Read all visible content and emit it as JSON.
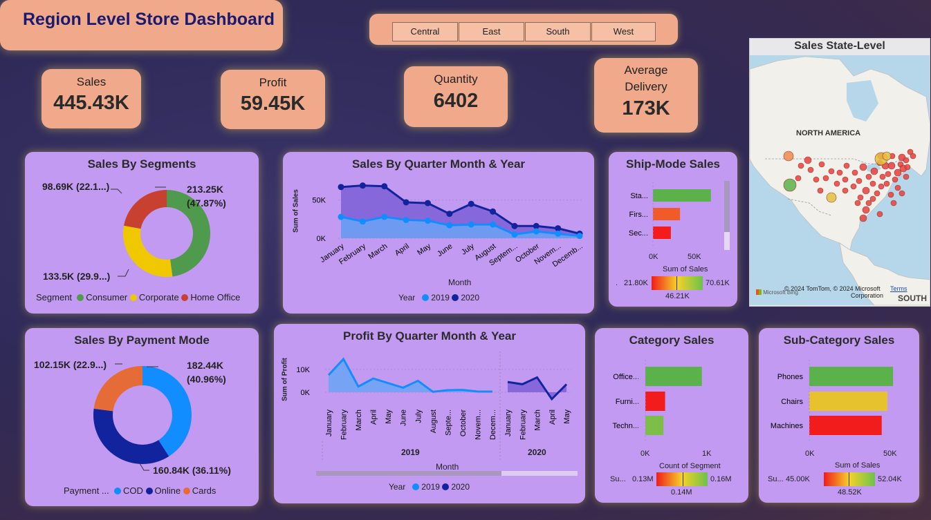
{
  "title": "Region Level Store Dashboard",
  "regions": [
    "Central",
    "East",
    "South",
    "West"
  ],
  "kpis": {
    "sales": {
      "label": "Sales",
      "value": "445.43K"
    },
    "profit": {
      "label": "Profit",
      "value": "59.45K"
    },
    "quantity": {
      "label": "Quantity",
      "value": "6402"
    },
    "delivery": {
      "label1": "Average",
      "label2": "Delivery",
      "value": "173K"
    }
  },
  "segments": {
    "title": "Sales By Segments",
    "legend_title": "Segment",
    "labels": {
      "consumer_1": "213.25K",
      "consumer_2": "(47.87%)",
      "corporate": "133.5K (29.9...)",
      "home": "98.69K (22.1...)"
    },
    "colors": {
      "Consumer": "#4f9a4d",
      "Corporate": "#f0c800",
      "Home Office": "#c84030"
    }
  },
  "payment": {
    "title": "Sales By Payment Mode",
    "legend_title": "Payment ...",
    "labels": {
      "cod_1": "182.44K",
      "cod_2": "(40.96%)",
      "online": "160.84K (36.11%)",
      "cards": "102.15K (22.9...)"
    },
    "colors": {
      "COD": "#118dff",
      "Online": "#12239e",
      "Cards": "#e66c37"
    }
  },
  "sales_qm": {
    "title": "Sales By Quarter Month & Year",
    "ylabel": "Sum of Sales",
    "xlabel": "Month",
    "legend_title": "Year",
    "month_labels": [
      "January",
      "February",
      "March",
      "April",
      "May",
      "June",
      "July",
      "August",
      "Septem...",
      "October",
      "Novem...",
      "Decemb..."
    ],
    "ytick_labels": [
      "50K",
      "0K"
    ]
  },
  "profit_qm": {
    "title": "Profit By Quarter Month & Year",
    "ylabel": "Sum of Profit",
    "xlabel": "Month",
    "legend_title": "Year",
    "month_labels_2019": [
      "January",
      "February",
      "March",
      "April",
      "May",
      "June",
      "July",
      "August",
      "Septe...",
      "October",
      "Novem...",
      "Decem..."
    ],
    "month_labels_2020": [
      "January",
      "February",
      "March",
      "April",
      "May"
    ],
    "year_labels": [
      "2019",
      "2020"
    ],
    "ytick_labels": [
      "10K",
      "0K"
    ]
  },
  "ship": {
    "title": "Ship-Mode Sales",
    "categories": [
      "Sta...",
      "Firs...",
      "Sec..."
    ],
    "ticks": [
      "0K",
      "50K"
    ],
    "axis_title": "Sum of Sales",
    "gradient": {
      "min": "21.80K",
      "mid": "46.21K",
      "max": "70.61K",
      "prefix": "."
    }
  },
  "category": {
    "title": "Category Sales",
    "categories": [
      "Office...",
      "Furni...",
      "Techn..."
    ],
    "ticks": [
      "0K",
      "1K"
    ],
    "axis_title": "Count of Segment",
    "gradient": {
      "min": "0.13M",
      "mid": "0.14M",
      "max": "0.16M",
      "prefix": "Su..."
    }
  },
  "subcategory": {
    "title": "Sub-Category Sales",
    "categories": [
      "Phones",
      "Chairs",
      "Machines"
    ],
    "ticks": [
      "0K",
      "50K"
    ],
    "axis_title": "Sum of Sales",
    "gradient": {
      "min": "45.00K",
      "mid": "48.52K",
      "max": "52.04K",
      "prefix": "Su..."
    }
  },
  "map": {
    "title": "Sales State-Level",
    "continent": "NORTH AMERICA",
    "copyright": "© 2024 TomTom, © 2024 Microsoft",
    "corporation": "Corporation",
    "terms": "Terms",
    "bing": "Microsoft Bing",
    "south": "SOUTH"
  },
  "chart_data": [
    {
      "type": "pie",
      "title": "Sales By Segments",
      "categories": [
        "Consumer",
        "Corporate",
        "Home Office"
      ],
      "values": [
        213.25,
        133.5,
        98.69
      ],
      "units": "K"
    },
    {
      "type": "pie",
      "title": "Sales By Payment Mode",
      "categories": [
        "COD",
        "Online",
        "Cards"
      ],
      "values": [
        182.44,
        160.84,
        102.15
      ],
      "units": "K"
    },
    {
      "type": "area",
      "title": "Sales By Quarter Month & Year",
      "xlabel": "Month",
      "ylabel": "Sum of Sales",
      "categories": [
        "January",
        "February",
        "March",
        "April",
        "May",
        "June",
        "July",
        "August",
        "September",
        "October",
        "November",
        "December"
      ],
      "ylim": [
        0,
        75000
      ],
      "series": [
        {
          "name": "2019",
          "color": "#118dff",
          "values": [
            28000,
            22000,
            28000,
            24000,
            23000,
            17000,
            18000,
            18000,
            5000,
            9000,
            6000,
            3000
          ]
        },
        {
          "name": "2020",
          "color": "#12239e",
          "values": [
            67000,
            69000,
            68000,
            47000,
            46000,
            32000,
            45000,
            35000,
            16000,
            16000,
            13000,
            6000
          ]
        }
      ]
    },
    {
      "type": "area",
      "title": "Profit By Quarter Month & Year",
      "xlabel": "Month",
      "ylabel": "Sum of Profit",
      "ylim": [
        -3000,
        16000
      ],
      "series": [
        {
          "name": "2019",
          "color": "#118dff",
          "x": [
            "January",
            "February",
            "March",
            "April",
            "May",
            "June",
            "July",
            "August",
            "September",
            "October",
            "November",
            "December"
          ],
          "values": [
            7500,
            14500,
            2500,
            6000,
            4000,
            2000,
            5000,
            200,
            900,
            1000,
            300,
            300
          ]
        },
        {
          "name": "2020",
          "color": "#12239e",
          "x": [
            "January",
            "February",
            "March",
            "April",
            "May"
          ],
          "values": [
            4500,
            3500,
            6500,
            -3000,
            3500
          ]
        }
      ]
    },
    {
      "type": "bar",
      "title": "Ship-Mode Sales",
      "orientation": "horizontal",
      "categories": [
        "Sta...",
        "Firs...",
        "Sec..."
      ],
      "values": [
        70610,
        33000,
        21800
      ],
      "xlim": [
        0,
        75000
      ],
      "colors": [
        "#5cb24a",
        "#f25a28",
        "#f21c1c"
      ]
    },
    {
      "type": "bar",
      "title": "Category Sales",
      "orientation": "horizontal",
      "categories": [
        "Office...",
        "Furni...",
        "Techn..."
      ],
      "values": [
        1000,
        350,
        320
      ],
      "xlim": [
        0,
        1150
      ],
      "colors": [
        "#5cb24a",
        "#f21c1c",
        "#7cbf48"
      ]
    },
    {
      "type": "bar",
      "title": "Sub-Category Sales",
      "orientation": "horizontal",
      "categories": [
        "Phones",
        "Chairs",
        "Machines"
      ],
      "values": [
        52040,
        48500,
        45000
      ],
      "xlim": [
        0,
        55000
      ],
      "colors": [
        "#5cb24a",
        "#e5c22e",
        "#f21c1c"
      ]
    }
  ]
}
